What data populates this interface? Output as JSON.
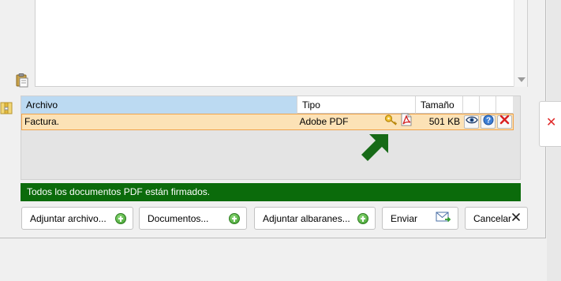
{
  "grid": {
    "headers": {
      "archivo": "Archivo",
      "tipo": "Tipo",
      "tamano": "Tamaño"
    },
    "rows": [
      {
        "archivo": "Factura.",
        "tipo": "Adobe PDF",
        "tamano": "501 KB"
      }
    ]
  },
  "status": {
    "message": "Todos los documentos PDF están firmados."
  },
  "buttons": {
    "adjuntar_archivo": "Adjuntar archivo...",
    "documentos": "Documentos...",
    "adjuntar_albaranes": "Adjuntar albaranes...",
    "enviar": "Enviar",
    "cancelar": "Cancelar"
  },
  "colors": {
    "status_bg": "#0b6b0b",
    "row_highlight": "#fce2b6",
    "row_border": "#f0a34a",
    "header_selected": "#bcdaf2",
    "arrow": "#176a17"
  },
  "icons": {
    "row": [
      "key-icon",
      "pdf-icon",
      "view-eye-icon",
      "help-icon",
      "delete-icon"
    ],
    "buttons": [
      "add-icon",
      "add-icon",
      "add-icon",
      "send-mail-icon",
      "close-icon"
    ]
  }
}
